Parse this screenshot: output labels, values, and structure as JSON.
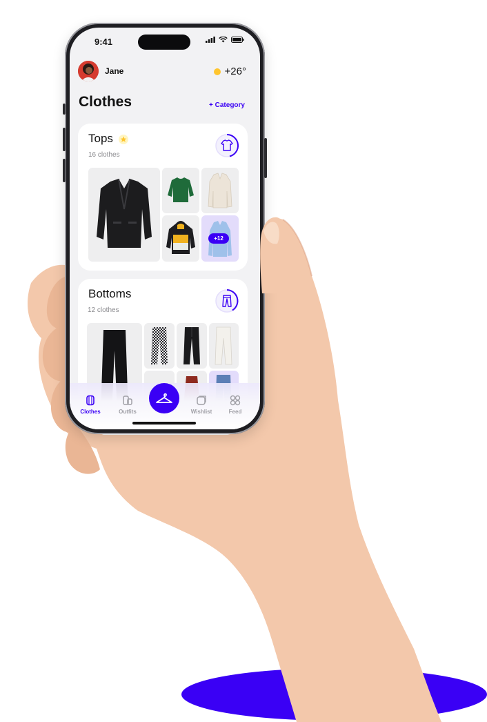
{
  "status_bar": {
    "time": "9:41"
  },
  "header": {
    "user_name": "Jane",
    "temperature": "+26°"
  },
  "page": {
    "title": "Clothes",
    "add_category_label": "+ Category"
  },
  "categories": [
    {
      "name": "Tops",
      "count_label": "16 clothes",
      "more_badge": "+12",
      "icon": "tshirt-icon"
    },
    {
      "name": "Bottoms",
      "count_label": "12 clothes",
      "icon": "pants-icon"
    }
  ],
  "tabbar": {
    "tabs": [
      {
        "label": "Clothes",
        "icon": "clothes-icon",
        "active": true
      },
      {
        "label": "Outfits",
        "icon": "outfits-icon",
        "active": false
      },
      {
        "label": "",
        "icon": "hanger-icon",
        "active": false
      },
      {
        "label": "Wishlist",
        "icon": "wishlist-icon",
        "active": false
      },
      {
        "label": "Feed",
        "icon": "feed-grid-icon",
        "active": false
      }
    ]
  },
  "colors": {
    "accent": "#3a00f5",
    "background": "#f2f2f4",
    "star": "#ffd23f"
  }
}
